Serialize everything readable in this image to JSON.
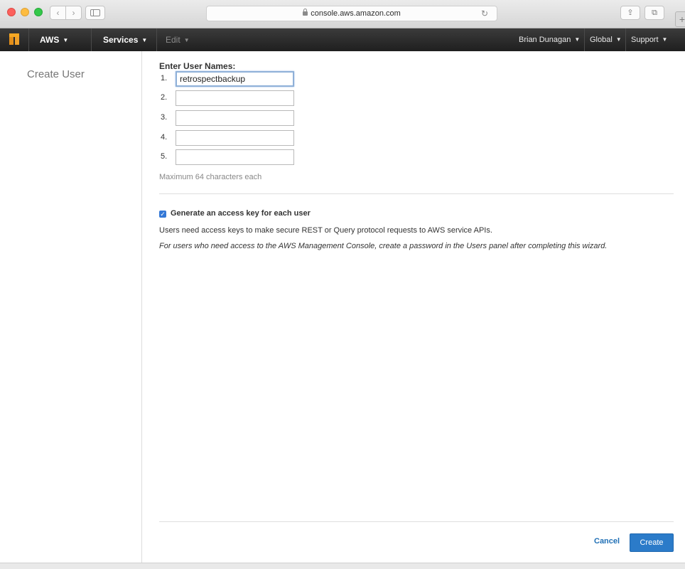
{
  "browser": {
    "url": "console.aws.amazon.com",
    "back_glyph": "‹",
    "forward_glyph": "›",
    "reload_glyph": "↻",
    "share_glyph": "⇪",
    "tabs_glyph": "⧉",
    "newtab_glyph": "+"
  },
  "navbar": {
    "brand": "AWS",
    "services": "Services",
    "edit": "Edit",
    "user": "Brian Dunagan",
    "region": "Global",
    "support": "Support",
    "caret": "▼"
  },
  "sidebar": {
    "title": "Create User"
  },
  "form": {
    "label": "Enter User Names:",
    "rows": [
      {
        "num": "1.",
        "value": ""
      },
      {
        "num": "2.",
        "value": ""
      },
      {
        "num": "3.",
        "value": ""
      },
      {
        "num": "4.",
        "value": ""
      },
      {
        "num": "5.",
        "value": ""
      }
    ],
    "first_value": "retrospectbackup",
    "hint": "Maximum 64 characters each",
    "checkbox_label": "Generate an access key for each user",
    "checkbox_checked": true,
    "checkbox_glyph": "✓",
    "description": "Users need access keys to make secure REST or Query protocol requests to AWS service APIs.",
    "description_italic": "For users who need access to the AWS Management Console, create a password in the Users panel after completing this wizard."
  },
  "actions": {
    "cancel": "Cancel",
    "create": "Create"
  },
  "colors": {
    "nav_bg": "#232f3e",
    "primary_button": "#2b7bc9",
    "link": "#1f6fb5",
    "checkbox": "#3478d6"
  }
}
